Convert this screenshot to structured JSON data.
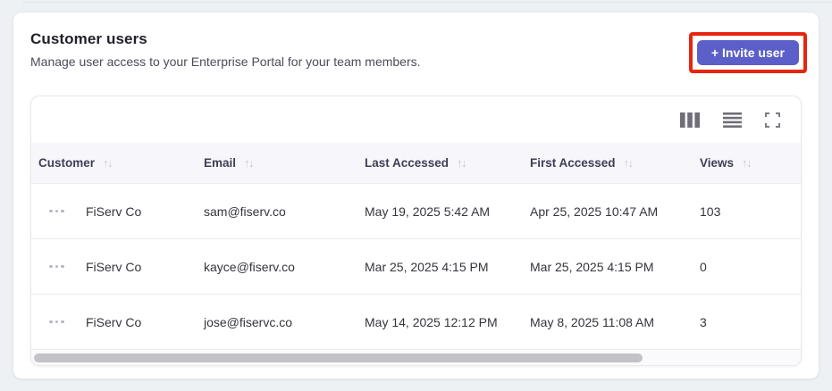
{
  "panel": {
    "title": "Customer users",
    "subtitle": "Manage user access to your Enterprise Portal for your team members.",
    "invite_button_label": "+ Invite user",
    "accent_color": "#5b5fc7",
    "highlight_color": "#e6250e"
  },
  "toolbar": {
    "icons": [
      "columns-icon",
      "density-icon",
      "fullscreen-icon"
    ]
  },
  "table": {
    "header_bg": "#f7f7fb",
    "sort_glyph": "↑↓",
    "columns": [
      {
        "label": "Customer"
      },
      {
        "label": "Email"
      },
      {
        "label": "Last Accessed"
      },
      {
        "label": "First Accessed"
      },
      {
        "label": "Views"
      }
    ],
    "rows": [
      {
        "customer": "FiServ Co",
        "email": "sam@fiserv.co",
        "last_accessed": "May 19, 2025 5:42 AM",
        "first_accessed": "Apr 25, 2025 10:47 AM",
        "views": "103"
      },
      {
        "customer": "FiServ Co",
        "email": "kayce@fiserv.co",
        "last_accessed": "Mar 25, 2025 4:15 PM",
        "first_accessed": "Mar 25, 2025 4:15 PM",
        "views": "0"
      },
      {
        "customer": "FiServ Co",
        "email": "jose@fiservc.co",
        "last_accessed": "May 14, 2025 12:12 PM",
        "first_accessed": "May 8, 2025 11:08 AM",
        "views": "3"
      }
    ]
  }
}
